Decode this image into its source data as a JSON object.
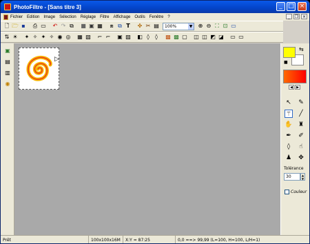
{
  "window": {
    "title": "PhotoFiltre - [Sans titre 3]"
  },
  "menu": [
    "Fichier",
    "Edition",
    "Image",
    "Sélection",
    "Réglage",
    "Filtre",
    "Affichage",
    "Outils",
    "Fenêtre",
    "?"
  ],
  "zoom": {
    "value": "100%"
  },
  "tolerance": {
    "label": "Tolérance",
    "value": "30"
  },
  "couleur": {
    "label": "Couleur"
  },
  "status": {
    "ready": "Prêt",
    "size": "100x100x16M",
    "xy": "X:Y = 87:25",
    "info": "0,0 ==> 99,99 (L=100, H=100, L/H=1)"
  },
  "colors": {
    "foreground": "#ffff00",
    "background": "#ffffff",
    "gradient_start": "#ff6a00",
    "gradient_end": "#ff0000"
  }
}
